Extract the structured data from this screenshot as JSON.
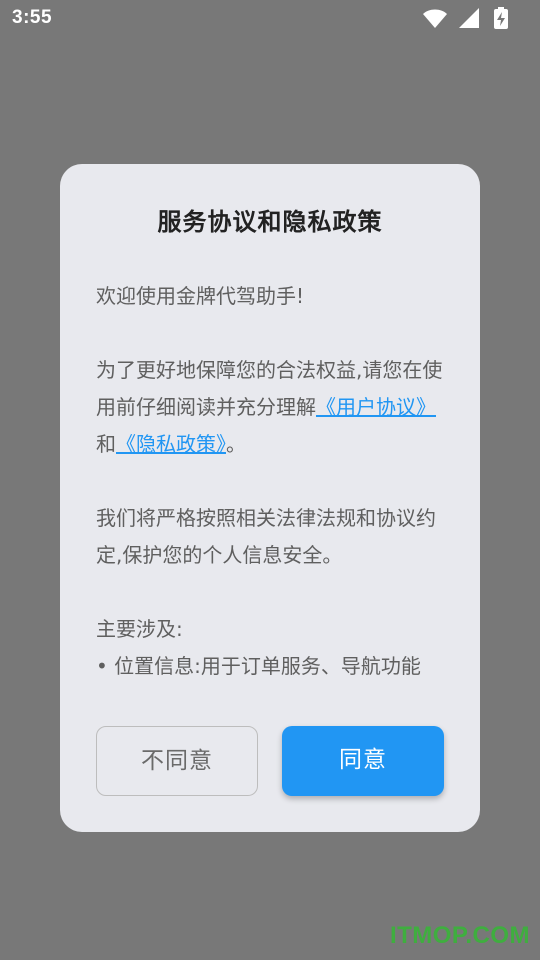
{
  "status_bar": {
    "time": "3:55",
    "icons": [
      "wifi-icon",
      "signal-icon",
      "battery-charging-icon"
    ],
    "icon_color": "#ffffff"
  },
  "dialog": {
    "title": "服务协议和隐私政策",
    "welcome": "欢迎使用金牌代驾助手!",
    "para1_prefix": "为了更好地保障您的合法权益,请您在使用前仔细阅读并充分理解",
    "link_user_agreement": "《用户协议》",
    "para1_and": "和",
    "link_privacy_policy": "《隐私政策》",
    "para1_suffix": "。",
    "para2": "我们将严格按照相关法律法规和协议约定,保护您的个人信息安全。",
    "main_heading": "主要涉及:",
    "bullet1": "• 位置信息:用于订单服务、导航功能",
    "disagree_label": "不同意",
    "agree_label": "同意"
  },
  "colors": {
    "backdrop": "#787878",
    "dialog_bg": "#e8e9ee",
    "accent": "#2196f3",
    "link": "#2196f3"
  },
  "watermark": "ITMOP.COM"
}
